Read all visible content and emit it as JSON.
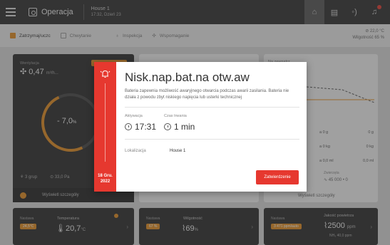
{
  "header": {
    "title": "Operacja",
    "house": "House 1",
    "datetime": "17:32, Dzień 23"
  },
  "subbar": {
    "items": [
      {
        "label": "Zatrzymaj/uczc",
        "active": true
      },
      {
        "label": "Chwytanie",
        "active": false
      },
      {
        "label": "Inspekcja",
        "active": false
      },
      {
        "label": "Wspomaganie",
        "active": false
      }
    ],
    "temperature": "⊘ 22,0 °C",
    "humidity": "Wilgotność 65 %"
  },
  "left_card": {
    "label": "Wentylacja",
    "value": "0,47",
    "unit": "m³/h...",
    "gauge_value": "- 7,0",
    "gauge_unit": "%",
    "footer_left": "3 grup",
    "footer_right": "33,0 Pa",
    "link": "Wyświetl szczegóły"
  },
  "right_card": {
    "label": "Na zewnątrz",
    "rows": [
      [
        "a 0 g",
        "0 g"
      ],
      [
        "a 0 kg",
        "0 kg"
      ],
      [
        "a 0,0 ml",
        "0,0 ml"
      ]
    ],
    "footer_label": "Zwierzęta",
    "footer_value": "∿ 45 000 • 0",
    "link": "Wyświetl szczegóły"
  },
  "bottom_cards": [
    {
      "label": "Nastawa",
      "pill": "24,5°C",
      "name": "Temperatura",
      "value": "20,7",
      "unit": "°C"
    },
    {
      "label": "Nastawa",
      "pill": "67 %",
      "name": "Wilgotność",
      "value": "69",
      "unit": "%"
    },
    {
      "label": "Nastawa",
      "pill": "3 471 ppm/auto",
      "name": "Jakość powietrza",
      "value": "2500",
      "unit": "ppm",
      "sub": "NH₃ 40,0 ppm"
    }
  ],
  "modal": {
    "title": "Nisk.nap.bat.na otw.aw",
    "description": "Bateria zapewnia możliwość awaryjnego otwarcia podczas awarii zasilania. Bateria nie działa z powodu zbyt niskiego napięcia lub usterki technicznej",
    "activation_label": "Aktywacja",
    "activation_value": "17:31",
    "duration_label": "Czas trwania",
    "duration_value": "1 min",
    "location_label": "Lokalizacja",
    "location_value": "House 1",
    "date_line1": "18 Gru.",
    "date_line2": "2022",
    "confirm_label": "Zatwierdzenie"
  },
  "colors": {
    "alarm_red": "#e6382f",
    "accent_orange": "#e08a1f",
    "dark": "#2b2b2b"
  }
}
